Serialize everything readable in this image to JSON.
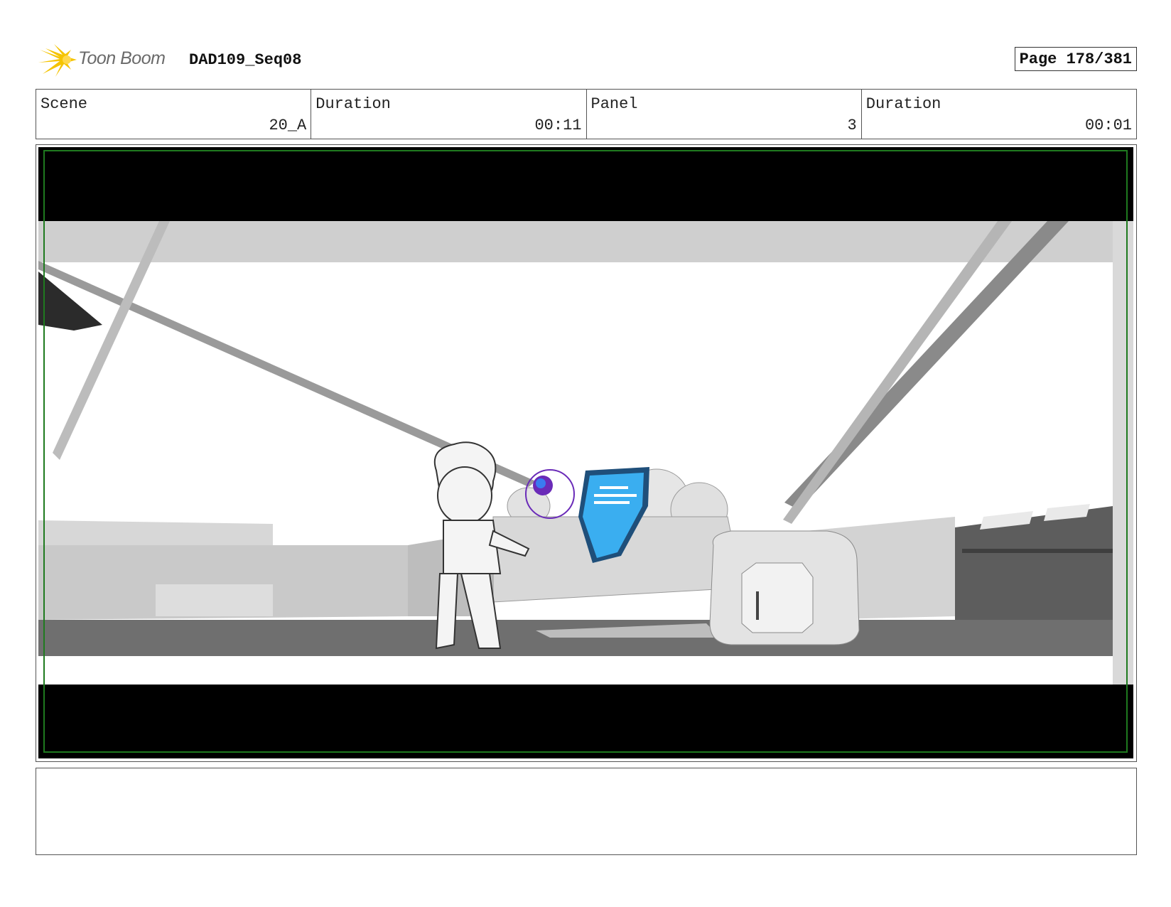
{
  "header": {
    "logo_text": "Toon Boom",
    "project": "DAD109_Seq08",
    "page_label": "Page 178/381"
  },
  "info": {
    "scene_label": "Scene",
    "scene_value": "20_A",
    "scene_duration_label": "Duration",
    "scene_duration_value": "00:11",
    "panel_label": "Panel",
    "panel_value": "3",
    "panel_duration_label": "Duration",
    "panel_duration_value": "00:01"
  },
  "colors": {
    "safe_frame": "#1f7a1f",
    "screen_blue": "#3aaef0",
    "robot_purple": "#6a2bb8",
    "logo_yellow": "#f5c400"
  },
  "notes": {
    "text": ""
  }
}
